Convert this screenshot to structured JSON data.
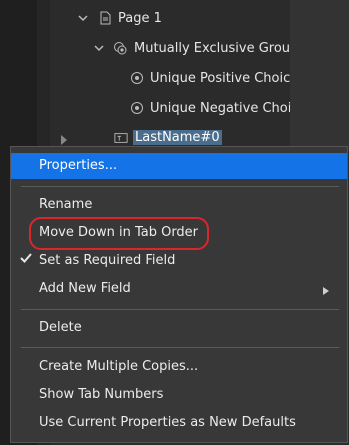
{
  "tree": {
    "page": "Page 1",
    "group": "Mutually Exclusive Group",
    "choice1": "Unique Positive Choice",
    "choice2": "Unique Negative Choic",
    "field": "LastName#0"
  },
  "menu": {
    "properties": "Properties...",
    "rename": "Rename",
    "move_down": "Move Down in Tab Order",
    "required": "Set as Required Field",
    "add_new_field": "Add New Field",
    "delete": "Delete",
    "create_copies": "Create Multiple Copies...",
    "show_tab_numbers": "Show Tab Numbers",
    "use_defaults": "Use Current Properties as New Defaults"
  },
  "colors": {
    "highlight": "#1473e6",
    "annotation": "#d9272e",
    "menu_bg": "#383838"
  }
}
